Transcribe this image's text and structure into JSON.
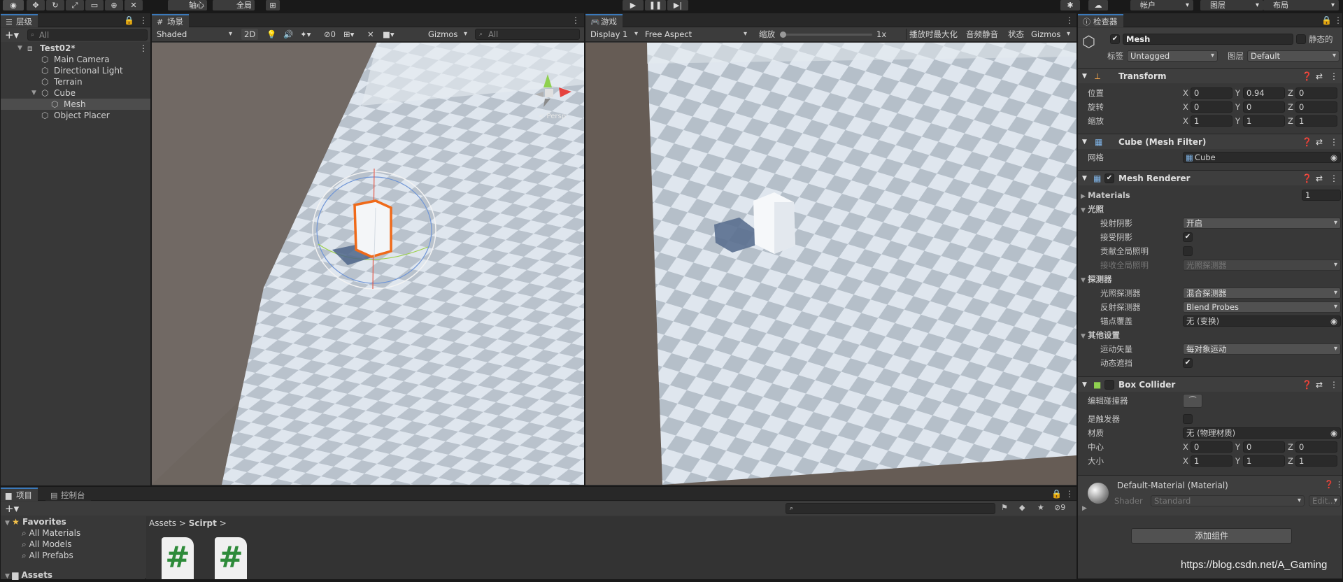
{
  "toolbar": {
    "pivot": "轴心",
    "global": "全局",
    "account": "帐户",
    "layers": "图层",
    "layout": "布局"
  },
  "hierarchy": {
    "tab": "层级",
    "search_placeholder": "All",
    "items": [
      {
        "label": "Test02*",
        "level": 0
      },
      {
        "label": "Main Camera",
        "level": 1
      },
      {
        "label": "Directional Light",
        "level": 1
      },
      {
        "label": "Terrain",
        "level": 1
      },
      {
        "label": "Cube",
        "level": 1
      },
      {
        "label": "Mesh",
        "level": 2
      },
      {
        "label": "Object Placer",
        "level": 1
      }
    ]
  },
  "scene": {
    "tab": "场景",
    "shading": "Shaded",
    "mode2d": "2D",
    "hidden_count": "0",
    "gizmos": "Gizmos",
    "search_placeholder": "All",
    "persp_label": "< Persp"
  },
  "game": {
    "tab": "游戏",
    "display": "Display 1",
    "aspect": "Free Aspect",
    "scale_label": "缩放",
    "scale_value": "1x",
    "maximize": "播放时最大化",
    "mute": "音频静音",
    "stats": "状态",
    "gizmos": "Gizmos"
  },
  "inspector": {
    "tab": "检查器",
    "object_name": "Mesh",
    "static_label": "静态的",
    "tag_label": "标签",
    "tag": "Untagged",
    "layer_label": "图层",
    "layer": "Default",
    "transform": {
      "title": "Transform",
      "position": {
        "label": "位置",
        "x": "0",
        "y": "0.94",
        "z": "0"
      },
      "rotation": {
        "label": "旋转",
        "x": "0",
        "y": "0",
        "z": "0"
      },
      "scale": {
        "label": "缩放",
        "x": "1",
        "y": "1",
        "z": "1"
      }
    },
    "mesh_filter": {
      "title": "Cube (Mesh Filter)",
      "mesh_label": "网格",
      "mesh": "Cube"
    },
    "mesh_renderer": {
      "title": "Mesh Renderer",
      "materials_label": "Materials",
      "materials_count": "1",
      "lighting": "光照",
      "cast_shadows_label": "投射阴影",
      "cast_shadows": "开启",
      "receive_shadows_label": "接受阴影",
      "contribute_gi_label": "贡献全局照明",
      "receive_gi_label": "接收全局照明",
      "receive_gi": "光照探测器",
      "probes": "探测器",
      "light_probes_label": "光照探测器",
      "light_probes": "混合探测器",
      "reflection_probes_label": "反射探测器",
      "reflection_probes": "Blend Probes",
      "anchor_label": "锚点覆盖",
      "anchor": "无 (变换)",
      "other": "其他设置",
      "motion_label": "运动矢量",
      "motion": "每对象运动",
      "dynamic_occlusion_label": "动态遮挡"
    },
    "box_collider": {
      "title": "Box Collider",
      "edit_label": "编辑碰撞器",
      "trigger_label": "是触发器",
      "material_label": "材质",
      "material": "无 (物理材质)",
      "center": {
        "label": "中心",
        "x": "0",
        "y": "0",
        "z": "0"
      },
      "size": {
        "label": "大小",
        "x": "1",
        "y": "1",
        "z": "1"
      }
    },
    "material": {
      "title": "Default-Material (Material)",
      "shader_label": "Shader",
      "shader": "Standard",
      "edit": "Edit..."
    },
    "add_component": "添加组件"
  },
  "project": {
    "tab_project": "项目",
    "tab_console": "控制台",
    "favorites": "Favorites",
    "fav_items": [
      "All Materials",
      "All Models",
      "All Prefabs"
    ],
    "assets": "Assets",
    "breadcrumb": [
      "Assets",
      "Scirpt"
    ],
    "hidden_count": "9",
    "file_glyph": "#"
  },
  "watermark": "https://blog.csdn.net/A_Gaming"
}
